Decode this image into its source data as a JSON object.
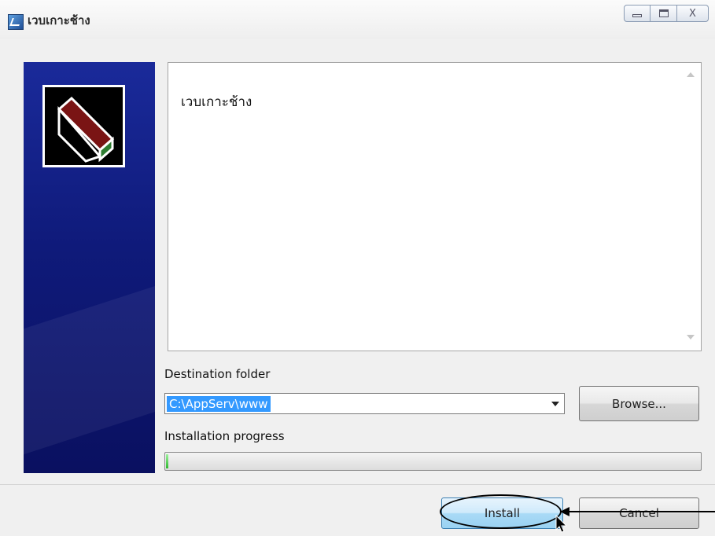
{
  "window": {
    "title": "เวบเกาะช้าง",
    "caption_buttons": [
      "minimize",
      "maximize",
      "close"
    ],
    "close_glyph": "X"
  },
  "panel": {
    "text": "เวบเกาะช้าง"
  },
  "destination": {
    "label": "Destination folder",
    "value": "C:\\AppServ\\www",
    "browse_label": "Browse..."
  },
  "progress": {
    "label": "Installation progress",
    "fraction": 0.005
  },
  "footer": {
    "install_label": "Install",
    "cancel_label": "Cancel"
  },
  "colors": {
    "sidebar": "#0f1a7a",
    "selection": "#3399ff",
    "progress_fill": "#2eb82e"
  }
}
